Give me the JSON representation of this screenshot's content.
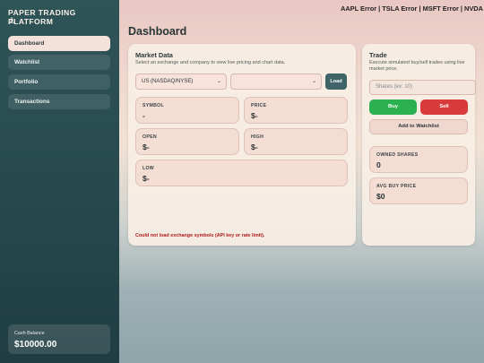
{
  "app": {
    "title": "PAPER TRADING PLATFORM",
    "logo_glyph": "⚓"
  },
  "sidebar": {
    "items": [
      {
        "label": "Dashboard",
        "active": true
      },
      {
        "label": "Watchlist",
        "active": false
      },
      {
        "label": "Portfolio",
        "active": false
      },
      {
        "label": "Transactions",
        "active": false
      }
    ],
    "balance": {
      "label": "Cash Balance",
      "value": "$10000.00"
    }
  },
  "ticker": {
    "text": "AAPL Error | TSLA Error | MSFT Error | NVDA Error"
  },
  "page": {
    "title": "Dashboard"
  },
  "market": {
    "title": "Market Data",
    "subtitle": "Select an exchange and company to view live pricing and chart data.",
    "exchange_select": {
      "value": "US (NASDAQ/NYSE)"
    },
    "company_select": {
      "value": ""
    },
    "load_label": "Load",
    "fields": {
      "symbol": {
        "label": "SYMBOL",
        "value": "-"
      },
      "price": {
        "label": "PRICE",
        "value": "$-"
      },
      "open": {
        "label": "OPEN",
        "value": "$-"
      },
      "high": {
        "label": "HIGH",
        "value": "$-"
      },
      "low": {
        "label": "LOW",
        "value": "$-"
      }
    },
    "error": "Could not load exchange symbols (API key or rate limit)."
  },
  "trade": {
    "title": "Trade",
    "subtitle": "Execute simulated buy/sell trades using live market price.",
    "shares_placeholder": "Shares (ex: 10)",
    "buy_label": "Buy",
    "sell_label": "Sell",
    "watchlist_label": "Add to Watchlist",
    "owned": {
      "label": "OWNED SHARES",
      "value": "0"
    },
    "avg": {
      "label": "AVG BUY PRICE",
      "value": "$0"
    }
  },
  "colors": {
    "sidebar": "#2f5457",
    "accent_buy": "#2bb14f",
    "accent_sell": "#d93a3a",
    "error": "#b01a1a",
    "load_button": "#3e6468"
  }
}
